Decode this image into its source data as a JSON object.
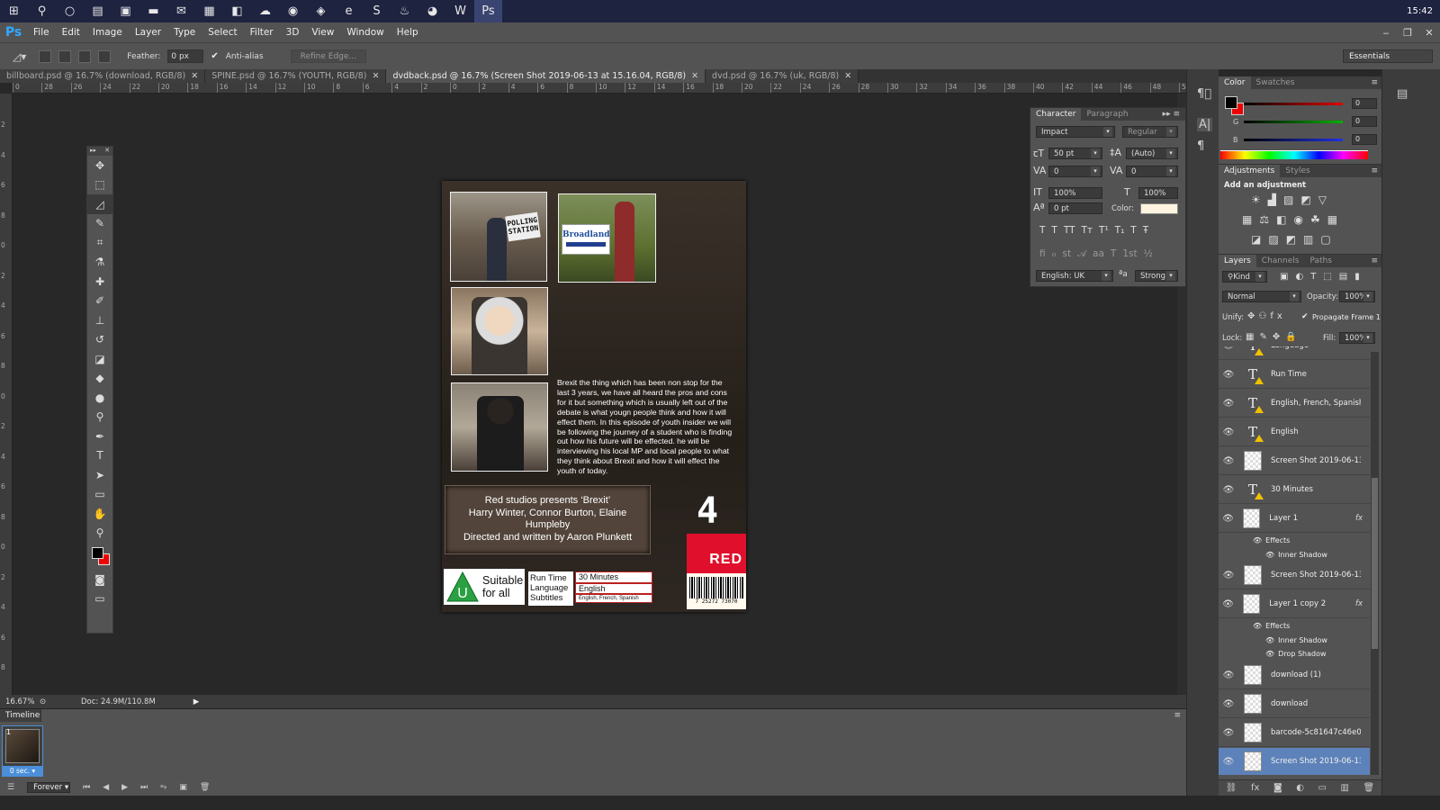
{
  "taskbar": {
    "icons": [
      {
        "name": "windows-start-icon",
        "glyph": "⊞"
      },
      {
        "name": "search-icon",
        "glyph": "⚲"
      },
      {
        "name": "cortana-icon",
        "glyph": "○"
      },
      {
        "name": "task-view-icon",
        "glyph": "▤"
      },
      {
        "name": "store-icon",
        "glyph": "▣"
      },
      {
        "name": "file-explorer-icon",
        "glyph": "▬"
      },
      {
        "name": "mail-icon",
        "glyph": "✉"
      },
      {
        "name": "calculator-icon",
        "glyph": "▦"
      },
      {
        "name": "office-icon",
        "glyph": "◧"
      },
      {
        "name": "onedrive-icon",
        "glyph": "☁"
      },
      {
        "name": "chrome-icon",
        "glyph": "◉"
      },
      {
        "name": "media-icon",
        "glyph": "◈"
      },
      {
        "name": "edge-icon",
        "glyph": "e"
      },
      {
        "name": "skype-icon",
        "glyph": "S"
      },
      {
        "name": "steam-icon",
        "glyph": "♨"
      },
      {
        "name": "firefox-icon",
        "glyph": "◕"
      },
      {
        "name": "word-icon",
        "glyph": "W"
      },
      {
        "name": "photoshop-taskbar-icon",
        "glyph": "Ps"
      }
    ],
    "clock": "15:42"
  },
  "menubar": {
    "logo": "Ps",
    "items": [
      "File",
      "Edit",
      "Image",
      "Layer",
      "Type",
      "Select",
      "Filter",
      "3D",
      "View",
      "Window",
      "Help"
    ],
    "window_controls": [
      "‒",
      "❐",
      "✕"
    ]
  },
  "options_bar": {
    "feather_label": "Feather:",
    "feather_value": "0 px",
    "antialias_label": "Anti-alias",
    "antialias_checked": true,
    "refine_edge_label": "Refine Edge...",
    "workspace": "Essentials"
  },
  "tabs": [
    {
      "label": "billboard.psd @ 16.7% (download, RGB/8)",
      "active": false
    },
    {
      "label": "SPINE.psd @ 16.7% (YOUTH, RGB/8)",
      "active": false
    },
    {
      "label": "dvdback.psd @ 16.7% (Screen Shot 2019-06-13 at 15.16.04, RGB/8)",
      "active": true
    },
    {
      "label": "dvd.psd @ 16.7% (uk, RGB/8)",
      "active": false
    }
  ],
  "ruler_top": [
    "0",
    "28",
    "26",
    "24",
    "22",
    "20",
    "18",
    "16",
    "14",
    "12",
    "10",
    "8",
    "6",
    "4",
    "2",
    "0",
    "2",
    "4",
    "6",
    "8",
    "10",
    "12",
    "14",
    "16",
    "18",
    "20",
    "22",
    "24",
    "26",
    "28",
    "30",
    "32",
    "34",
    "36",
    "38",
    "40",
    "42",
    "44",
    "46",
    "48",
    "50"
  ],
  "ruler_left": [
    "2",
    "4",
    "6",
    "8",
    "0",
    "2",
    "4",
    "6",
    "8",
    "0",
    "2",
    "4",
    "6",
    "8",
    "0",
    "2",
    "4",
    "6",
    "8",
    "0"
  ],
  "toolbox": {
    "tools": [
      {
        "name": "move-tool-icon",
        "glyph": "✥"
      },
      {
        "name": "marquee-tool-icon",
        "glyph": "⬚"
      },
      {
        "name": "lasso-tool-icon",
        "glyph": "◿",
        "selected": true
      },
      {
        "name": "quick-select-tool-icon",
        "glyph": "✎"
      },
      {
        "name": "crop-tool-icon",
        "glyph": "⌗"
      },
      {
        "name": "eyedropper-tool-icon",
        "glyph": "⚗"
      },
      {
        "name": "healing-brush-tool-icon",
        "glyph": "✚"
      },
      {
        "name": "brush-tool-icon",
        "glyph": "✐"
      },
      {
        "name": "clone-stamp-tool-icon",
        "glyph": "⊥"
      },
      {
        "name": "history-brush-tool-icon",
        "glyph": "↺"
      },
      {
        "name": "eraser-tool-icon",
        "glyph": "◪"
      },
      {
        "name": "paint-bucket-tool-icon",
        "glyph": "◆"
      },
      {
        "name": "blur-tool-icon",
        "glyph": "●"
      },
      {
        "name": "dodge-tool-icon",
        "glyph": "⚲"
      },
      {
        "name": "pen-tool-icon",
        "glyph": "✒"
      },
      {
        "name": "type-tool-icon",
        "glyph": "T"
      },
      {
        "name": "path-select-tool-icon",
        "glyph": "➤"
      },
      {
        "name": "rectangle-tool-icon",
        "glyph": "▭"
      },
      {
        "name": "hand-tool-icon",
        "glyph": "✋"
      },
      {
        "name": "zoom-tool-icon",
        "glyph": "⚲"
      }
    ],
    "fg_color": "#000000",
    "bg_color": "#e01010",
    "bottom_tools": [
      {
        "name": "quick-mask-icon",
        "glyph": "◙"
      },
      {
        "name": "screen-mode-icon",
        "glyph": "▭"
      }
    ]
  },
  "document": {
    "polling_sign": "POLLING\nSTATION",
    "broadland_sign": "Broadland",
    "blurb": "Brexit the thing which has been non stop for the last 3 years, we have all heard the pros and cons for it but something which is usually left out of the debate is what yougn people think and how it will effect them. In this episode of youth insider we will be following the journey of a student who is finding out how his future will be effected. he will be interviewing his local MP and local people to what they think about Brexit and how it will effect the youth of today.",
    "credits": [
      "Red studios presents ‘Brexit’",
      "Harry Winter, Connor Burton, Elaine Humpleby",
      "Directed and written by Aaron Plunkett"
    ],
    "channel_logo": "4",
    "red_badge": "RED",
    "barcode_number": "7 25272 73070",
    "rating_letter": "U",
    "rating_text": [
      "Suitable",
      "for all"
    ],
    "info_labels": [
      "Run Time",
      "Language",
      "Subtitles"
    ],
    "info_values": [
      "30 Minutes",
      "English",
      "English, French, Spanish"
    ]
  },
  "character_panel": {
    "tabs": [
      "Character",
      "Paragraph"
    ],
    "font_family": "Impact",
    "font_style": "Regular",
    "font_size": "50 pt",
    "leading": "(Auto)",
    "kerning": "0",
    "tracking": "0",
    "vertical_scale": "100%",
    "horizontal_scale": "100%",
    "baseline_shift": "0 pt",
    "color_label": "Color:",
    "text_color": "#fff4e0",
    "style_buttons": [
      "T",
      "T",
      "TT",
      "Tт",
      "T¹",
      "T₁",
      "T",
      "Ŧ"
    ],
    "opentype_buttons": [
      "ﬁ",
      "ℴ",
      "st",
      "𝒜",
      "aa",
      "T",
      "1st",
      "½"
    ],
    "language": "English: UK",
    "aa_label": "ªa",
    "antialias_method": "Strong"
  },
  "color_panel": {
    "tabs": [
      "Color",
      "Swatches"
    ],
    "channels": [
      {
        "label": "R",
        "value": "0",
        "color": "#e00000"
      },
      {
        "label": "G",
        "value": "0",
        "color": "#00b000"
      },
      {
        "label": "B",
        "value": "0",
        "color": "#2030e0"
      }
    ]
  },
  "adjustments_panel": {
    "tabs": [
      "Adjustments",
      "Styles"
    ],
    "hint": "Add an adjustment"
  },
  "layers_panel": {
    "tabs": [
      "Layers",
      "Channels",
      "Paths"
    ],
    "filter_kind": "Kind",
    "blend_mode": "Normal",
    "opacity_label": "Opacity:",
    "opacity": "100%",
    "unify_label": "Unify:",
    "propagate_label": "Propagate Frame 1",
    "lock_label": "Lock:",
    "fill_label": "Fill:",
    "fill": "100%",
    "layers": [
      {
        "name": "Language",
        "type": "text",
        "partial": true
      },
      {
        "name": "Run Time",
        "type": "text"
      },
      {
        "name": "English, French, Spanish",
        "type": "text"
      },
      {
        "name": "English",
        "type": "text"
      },
      {
        "name": "Screen Shot 2019-06-13 ...",
        "type": "image"
      },
      {
        "name": "30 Minutes",
        "type": "text"
      },
      {
        "name": "Layer 1",
        "type": "image",
        "fx": true,
        "effects": [
          "Effects",
          "Inner Shadow"
        ]
      },
      {
        "name": "Screen Shot 2019-06-13 ...",
        "type": "image"
      },
      {
        "name": "Layer 1 copy 2",
        "type": "image",
        "fx": true,
        "effects": [
          "Effects",
          "Inner Shadow",
          "Drop Shadow"
        ]
      },
      {
        "name": "download (1)",
        "type": "image"
      },
      {
        "name": "download",
        "type": "smart"
      },
      {
        "name": "barcode-5c81647c46e0fb...",
        "type": "smart"
      },
      {
        "name": "Screen Shot 2019-06-13 ...",
        "type": "image",
        "active": true
      }
    ],
    "fx_label": "fx",
    "bottom_icons": [
      "⛓",
      "fx",
      "◙",
      "◐",
      "▭",
      "▥",
      "🗑"
    ]
  },
  "status": {
    "zoom": "16.67%",
    "doc_info": "Doc: 24.9M/110.8M"
  },
  "timeline": {
    "title": "Timeline",
    "frame_number": "1",
    "frame_delay": "0 sec.",
    "loop": "Forever",
    "controls": [
      "⏮",
      "◀",
      "▶",
      "⏭",
      "⥱",
      "▣",
      "🗑"
    ]
  }
}
